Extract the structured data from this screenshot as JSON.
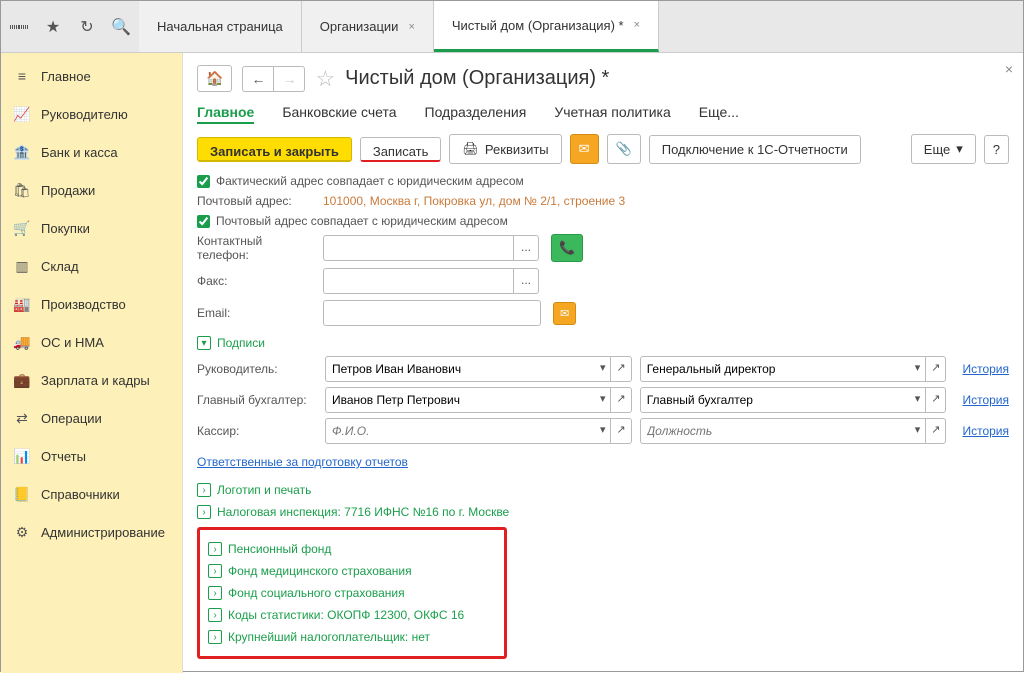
{
  "topbar": {
    "tabs": [
      {
        "label": "Начальная страница"
      },
      {
        "label": "Организации"
      },
      {
        "label": "Чистый дом (Организация) *"
      }
    ]
  },
  "sidebar": {
    "items": [
      {
        "icon": "≡",
        "label": "Главное"
      },
      {
        "icon": "📈",
        "label": "Руководителю"
      },
      {
        "icon": "🏦",
        "label": "Банк и касса"
      },
      {
        "icon": "🛍",
        "label": "Продажи"
      },
      {
        "icon": "🛒",
        "label": "Покупки"
      },
      {
        "icon": "▥",
        "label": "Склад"
      },
      {
        "icon": "🏭",
        "label": "Производство"
      },
      {
        "icon": "🚚",
        "label": "ОС и НМА"
      },
      {
        "icon": "💼",
        "label": "Зарплата и кадры"
      },
      {
        "icon": "⇄",
        "label": "Операции"
      },
      {
        "icon": "📊",
        "label": "Отчеты"
      },
      {
        "icon": "📒",
        "label": "Справочники"
      },
      {
        "icon": "⚙",
        "label": "Администрирование"
      }
    ]
  },
  "header": {
    "title": "Чистый дом (Организация) *"
  },
  "subtabs": [
    "Главное",
    "Банковские счета",
    "Подразделения",
    "Учетная политика",
    "Еще..."
  ],
  "toolbar": {
    "save_close": "Записать и закрыть",
    "save": "Записать",
    "props": "Реквизиты",
    "connect": "Подключение к 1С-Отчетности",
    "more": "Еще",
    "help": "?"
  },
  "form": {
    "fact_same": "Фактический адрес совпадает с юридическим адресом",
    "post_lbl": "Почтовый адрес:",
    "post_addr": "101000, Москва г, Покровка ул, дом № 2/1, строение 3",
    "post_same": "Почтовый адрес совпадает с юридическим адресом",
    "phone_lbl": "Контактный телефон:",
    "fax_lbl": "Факс:",
    "email_lbl": "Email:",
    "dots": "..."
  },
  "signs": {
    "title": "Подписи",
    "head_lbl": "Руководитель:",
    "head_val": "Петров Иван Иванович",
    "head_post": "Генеральный директор",
    "acc_lbl": "Главный бухгалтер:",
    "acc_val": "Иванов Петр Петрович",
    "acc_post": "Главный бухгалтер",
    "cash_lbl": "Кассир:",
    "cash_val": "Ф.И.О.",
    "cash_post": "Должность",
    "history": "История",
    "resp_link": "Ответственные за подготовку отчетов"
  },
  "expanders": {
    "logo": "Логотип и печать",
    "tax": "Налоговая инспекция: 7716 ИФНС №16 по г. Москве",
    "pfr": "Пенсионный фонд",
    "fms": "Фонд медицинского страхования",
    "fss": "Фонд социального страхования",
    "stat": "Коды статистики: ОКОПФ 12300, ОКФС 16",
    "big": "Крупнейший налогоплательщик: нет"
  }
}
